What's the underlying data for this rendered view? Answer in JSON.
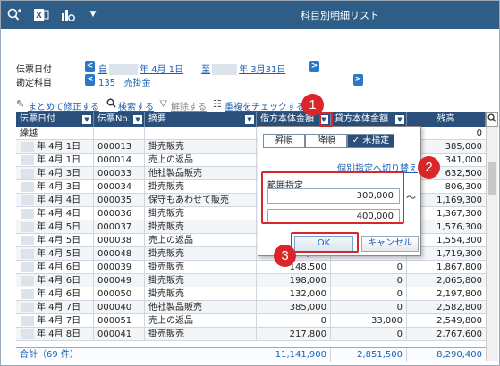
{
  "window": {
    "title": "科目別明細リスト"
  },
  "titlebar_icons": [
    "search-plus-icon",
    "excel-icon",
    "chart-settings-icon",
    "dropdown-icon"
  ],
  "filters": {
    "date_label": "伝票日付",
    "date_from_era": "自",
    "date_from": "年  4月 1日",
    "date_sep": "至",
    "date_to": "年  3月31日",
    "account_label": "勘定科目",
    "account_code": "135",
    "account_name": "売掛金"
  },
  "toolbar": {
    "bulk_edit": "まとめて修正する",
    "search": "検索する",
    "clear": "解除する",
    "dup_check": "重複をチェックする"
  },
  "columns": [
    "伝票日付",
    "伝票No.",
    "摘要",
    "借方本体金額",
    "貸方本体金額",
    "残高"
  ],
  "carryover": {
    "label": "繰越",
    "balance": "0"
  },
  "rows": [
    {
      "date": "年  4月  1日",
      "no": "000013",
      "memo": "掛売販売",
      "debit": "",
      "credit": "",
      "balance": "385,000"
    },
    {
      "date": "年  4月  1日",
      "no": "000014",
      "memo": "売上の返品",
      "debit": "",
      "credit": "",
      "balance": "341,000"
    },
    {
      "date": "年  4月  3日",
      "no": "000033",
      "memo": "他社製品販売",
      "debit": "",
      "credit": "",
      "balance": "632,500"
    },
    {
      "date": "年  4月  3日",
      "no": "000034",
      "memo": "掛売販売",
      "debit": "",
      "credit": "",
      "balance": "806,300"
    },
    {
      "date": "年  4月  4日",
      "no": "000035",
      "memo": "保守もあわせて販売",
      "debit": "",
      "credit": "",
      "balance": "1,169,300"
    },
    {
      "date": "年  4月  4日",
      "no": "000036",
      "memo": "掛売販売",
      "debit": "",
      "credit": "",
      "balance": "1,367,300"
    },
    {
      "date": "年  4月  5日",
      "no": "000037",
      "memo": "掛売販売",
      "debit": "",
      "credit": "",
      "balance": "1,576,300"
    },
    {
      "date": "年  4月  5日",
      "no": "000038",
      "memo": "売上の返品",
      "debit": "",
      "credit": "",
      "balance": "1,554,300"
    },
    {
      "date": "年  4月  5日",
      "no": "000048",
      "memo": "掛売販売",
      "debit": "165,000",
      "credit": "0",
      "balance": "1,719,300"
    },
    {
      "date": "年  4月  6日",
      "no": "000039",
      "memo": "掛売販売",
      "debit": "148,500",
      "credit": "0",
      "balance": "1,867,800"
    },
    {
      "date": "年  4月  6日",
      "no": "000049",
      "memo": "掛売販売",
      "debit": "198,000",
      "credit": "0",
      "balance": "2,065,800"
    },
    {
      "date": "年  4月  6日",
      "no": "000050",
      "memo": "掛売販売",
      "debit": "132,000",
      "credit": "0",
      "balance": "2,197,800"
    },
    {
      "date": "年  4月  7日",
      "no": "000040",
      "memo": "他社製品販売",
      "debit": "385,000",
      "credit": "0",
      "balance": "2,582,800"
    },
    {
      "date": "年  4月  7日",
      "no": "000051",
      "memo": "売上の返品",
      "debit": "0",
      "credit": "33,000",
      "balance": "2,549,800"
    },
    {
      "date": "年  4月  8日",
      "no": "000041",
      "memo": "掛売販売",
      "debit": "217,800",
      "credit": "0",
      "balance": "2,767,600"
    }
  ],
  "totals": {
    "label": "合計（69 件）",
    "debit": "11,141,900",
    "credit": "2,851,500",
    "balance": "8,290,400"
  },
  "popup": {
    "sort_asc": "昇順",
    "sort_desc": "降順",
    "sort_none": "✓ 未指定",
    "switch_link": "個別指定へ切り替え",
    "range_title": "範囲指定",
    "range_from": "300,000",
    "range_tilde": "〜",
    "range_to": "400,000",
    "ok": "OK",
    "cancel": "キャンセル"
  },
  "badges": [
    "1",
    "2",
    "3"
  ],
  "colors": {
    "titlebar": "#2e5e88",
    "header": "#2a4f7a",
    "annotation": "#d9262a",
    "link": "#1a5fb4"
  }
}
